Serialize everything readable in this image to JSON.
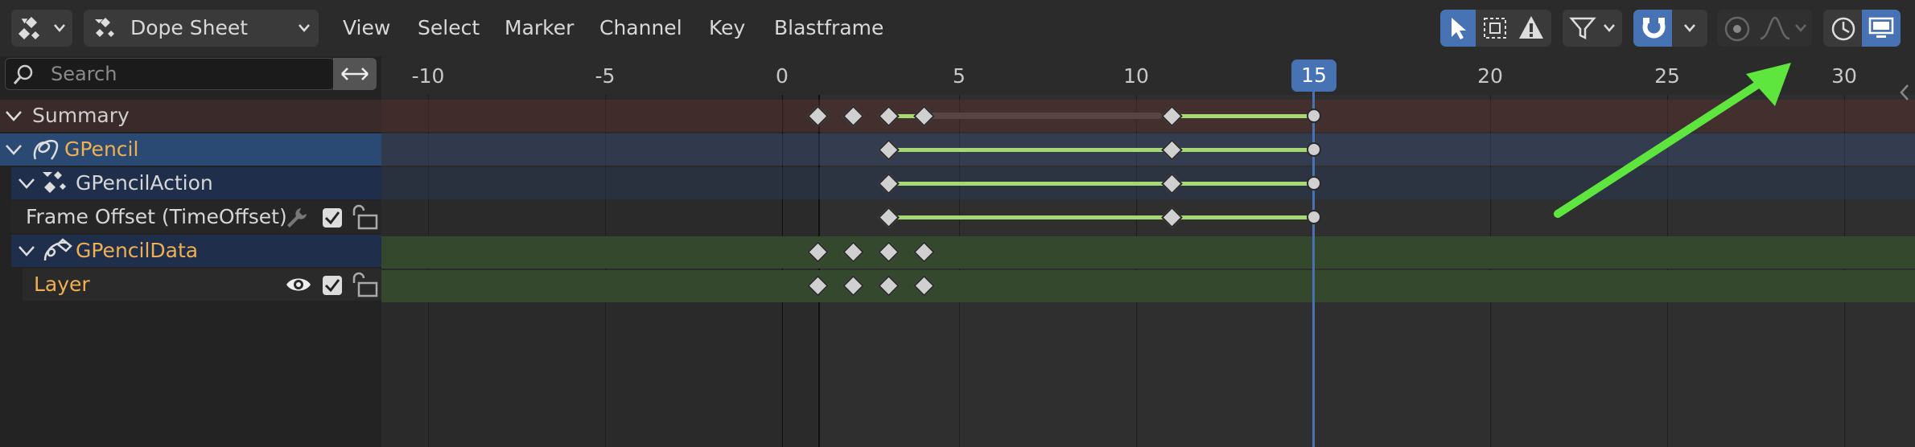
{
  "header": {
    "editor_type": "Dope Sheet",
    "menus": [
      "View",
      "Select",
      "Marker",
      "Channel",
      "Key",
      "Blastframe"
    ]
  },
  "search": {
    "placeholder": "Search"
  },
  "channels": [
    {
      "label": "Summary",
      "color": "#cfcfcf"
    },
    {
      "label": "GPencil",
      "color": "#f0b050"
    },
    {
      "label": "GPencilAction",
      "color": "#d6d6d6"
    },
    {
      "label": "Frame Offset (TimeOffset)",
      "color": "#d6d6d6"
    },
    {
      "label": "GPencilData",
      "color": "#f0b050"
    },
    {
      "label": "Layer",
      "color": "#f0b050"
    }
  ],
  "ruler": {
    "ticks": [
      "-10",
      "-5",
      "0",
      "5",
      "10",
      "15",
      "20",
      "25",
      "30"
    ],
    "current_frame": "15"
  },
  "colors": {
    "accent": "#4772b3",
    "summary_row": "#3b2a2a",
    "gpencil_row": "#2a3a55",
    "data_row": "#34482e",
    "key_line": "#a6d873",
    "annotation_arrow": "#5ee63f"
  }
}
